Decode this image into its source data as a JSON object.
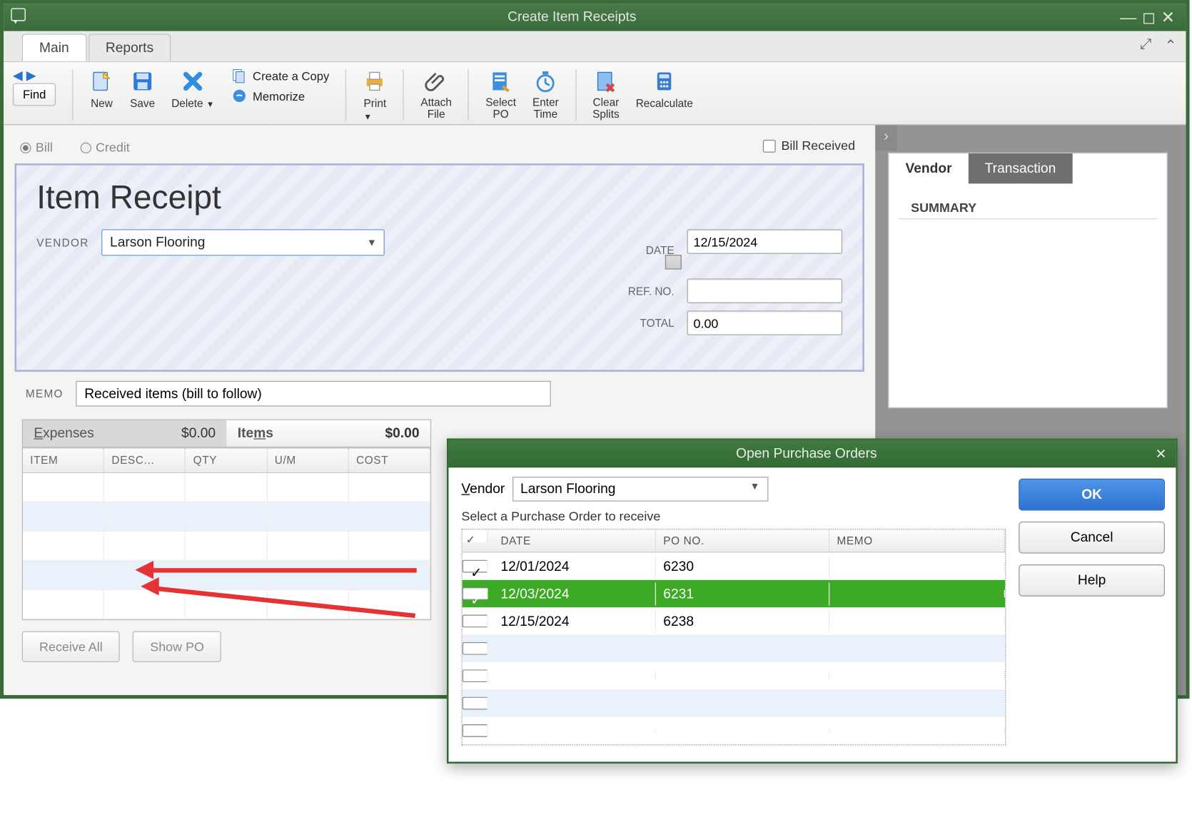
{
  "title": "Create Item Receipts",
  "menutabs": {
    "main": "Main",
    "reports": "Reports"
  },
  "toolbar": {
    "find": "Find",
    "new": "New",
    "save": "Save",
    "delete": "Delete",
    "create_copy": "Create a Copy",
    "memorize": "Memorize",
    "print": "Print",
    "attach": "Attach File",
    "select_po": "Select PO",
    "enter_time": "Enter Time",
    "clear_splits": "Clear Splits",
    "recalculate": "Recalculate"
  },
  "radios": {
    "bill": "Bill",
    "credit": "Credit",
    "bill_received": "Bill Received"
  },
  "receipt": {
    "heading": "Item Receipt",
    "vendor_label": "VENDOR",
    "vendor_value": "Larson Flooring",
    "date_label": "DATE",
    "date_value": "12/15/2024",
    "ref_label": "REF. NO.",
    "ref_value": "",
    "total_label": "TOTAL",
    "total_value": "0.00",
    "memo_label": "MEMO",
    "memo_value": "Received items (bill to follow)"
  },
  "subtabs": {
    "expenses_label": "Expenses",
    "expenses_amount": "$0.00",
    "items_label": "Items",
    "items_amount": "$0.00"
  },
  "grid_headers": {
    "item": "ITEM",
    "desc": "DESC...",
    "qty": "QTY",
    "um": "U/M",
    "cost": "COST"
  },
  "buttons": {
    "receive_all": "Receive All",
    "show_po": "Show PO"
  },
  "side": {
    "vendor_tab": "Vendor",
    "transaction_tab": "Transaction",
    "summary": "SUMMARY"
  },
  "dialog": {
    "title": "Open Purchase Orders",
    "vendor_label": "Vendor",
    "vendor_value": "Larson Flooring",
    "note": "Select a Purchase Order to receive",
    "headers": {
      "check": "✓",
      "date": "DATE",
      "po": "PO NO.",
      "memo": "MEMO"
    },
    "rows": [
      {
        "checked": true,
        "selected": false,
        "date": "12/01/2024",
        "po": "6230",
        "memo": ""
      },
      {
        "checked": true,
        "selected": true,
        "date": "12/03/2024",
        "po": "6231",
        "memo": ""
      },
      {
        "checked": false,
        "selected": false,
        "date": "12/15/2024",
        "po": "6238",
        "memo": ""
      }
    ],
    "ok": "OK",
    "cancel": "Cancel",
    "help": "Help"
  }
}
